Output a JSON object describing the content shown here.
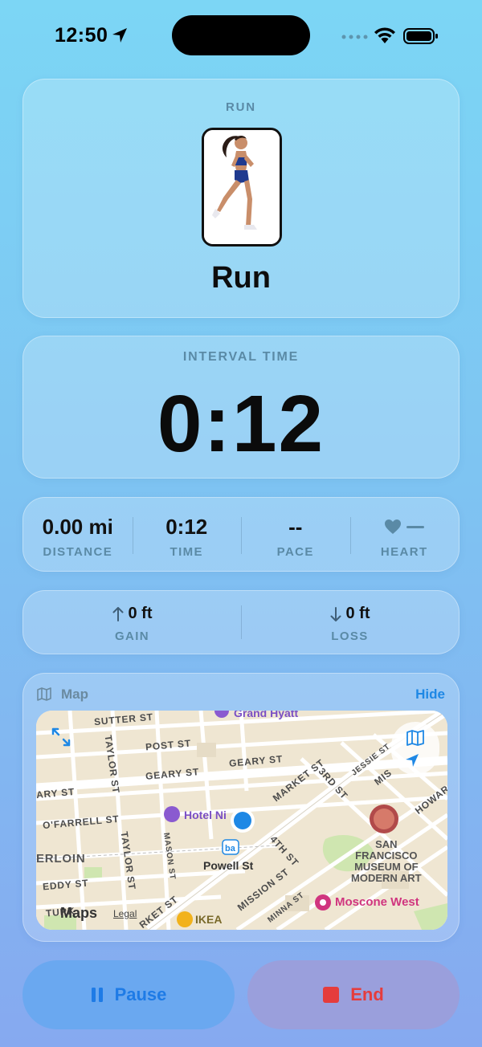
{
  "status_bar": {
    "time": "12:50"
  },
  "run_card": {
    "label": "RUN",
    "title": "Run"
  },
  "interval": {
    "label": "INTERVAL TIME",
    "value": "0:12"
  },
  "stats": [
    {
      "value": "0.00 mi",
      "label": "DISTANCE"
    },
    {
      "value": "0:12",
      "label": "TIME"
    },
    {
      "value": "--",
      "label": "PACE"
    },
    {
      "value": "",
      "label": "HEART"
    }
  ],
  "elevation": {
    "gain": {
      "value": "0 ft",
      "label": "GAIN"
    },
    "loss": {
      "value": "0 ft",
      "label": "LOSS"
    }
  },
  "map": {
    "title": "Map",
    "hide_label": "Hide",
    "streets": {
      "sutter": "SUTTER ST",
      "post": "POST ST",
      "geary1": "GEARY ST",
      "geary2": "GEARY ST",
      "geary3": "ARY ST",
      "taylor1": "TAYLOR ST",
      "taylor2": "TAYLOR ST",
      "ofarrell": "O'FARRELL ST",
      "mason": "MASON ST",
      "eddy": "EDDY ST",
      "market1": "MARKET ST",
      "market2": "RKET ST",
      "third": "3RD ST",
      "jessie": "JESSIE ST",
      "mis": "MIS",
      "howard": "HOWAR",
      "fourth": "4TH ST",
      "mission": "MISSION ST",
      "minna": "MINNA ST",
      "turk": "TURK",
      "tenderloin": "ERLOIN"
    },
    "pois": {
      "grand_hyatt": "Grand Hyatt",
      "hotel_nikko": "Hotel Ni",
      "powell": "Powell St",
      "sfmoma": "SAN\nFRANCISCO\nMUSEUM OF\nMODERN ART",
      "moscone": "Moscone West",
      "ikea": "IKEA"
    },
    "maps_logo": "Maps",
    "legal": "Legal"
  },
  "buttons": {
    "pause": "Pause",
    "end": "End"
  },
  "colors": {
    "accent_blue": "#1e88e5",
    "end_red": "#e53c3c",
    "label_muted": "#5a8aa6"
  }
}
